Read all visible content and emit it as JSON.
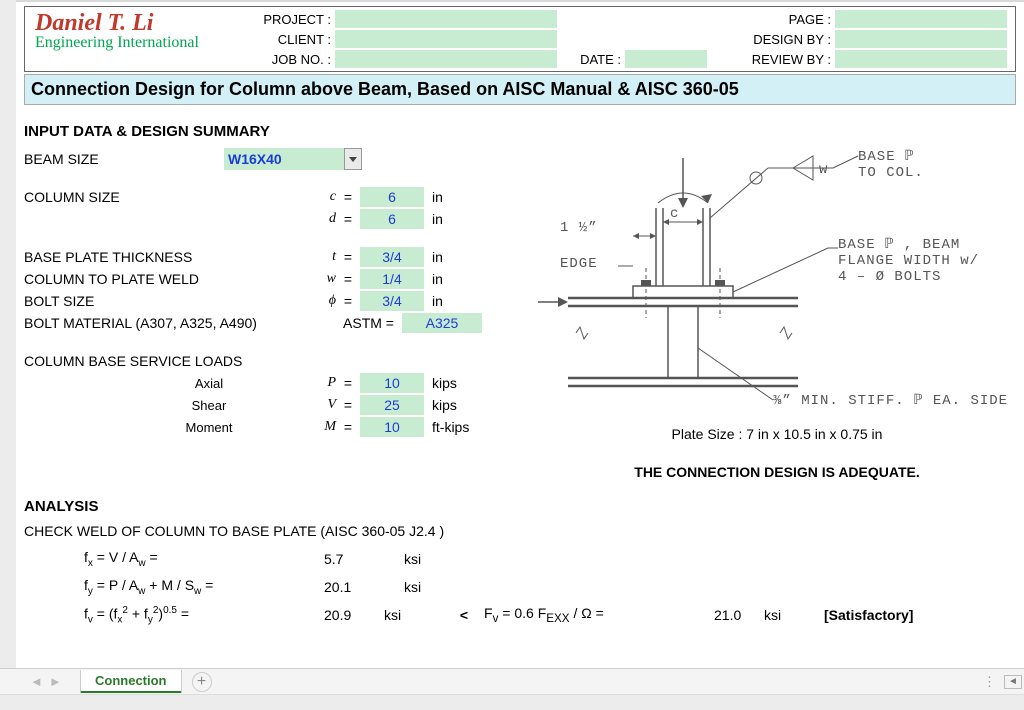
{
  "logo": {
    "name": "Daniel T. Li",
    "sub": "Engineering International"
  },
  "header": {
    "project": "PROJECT :",
    "client": "CLIENT :",
    "jobno": "JOB NO. :",
    "date": "DATE :",
    "page": "PAGE :",
    "design_by": "DESIGN BY :",
    "review_by": "REVIEW BY :"
  },
  "title": "Connection Design for Column above Beam, Based on AISC Manual & AISC 360-05",
  "sections": {
    "input": "INPUT DATA & DESIGN SUMMARY",
    "analysis": "ANALYSIS"
  },
  "beam": {
    "label": "BEAM SIZE",
    "value": "W16X40"
  },
  "column": {
    "label": "COLUMN SIZE",
    "c_sym": "c",
    "c_val": "6",
    "c_unit": "in",
    "d_sym": "d",
    "d_val": "6",
    "d_unit": "in"
  },
  "plate": {
    "t_label": "BASE PLATE THICKNESS",
    "t_sym": "t",
    "t_val": "3/4",
    "t_unit": "in",
    "w_label": "COLUMN TO PLATE WELD",
    "w_sym": "w",
    "w_val": "1/4",
    "w_unit": "in",
    "phi_label": "BOLT SIZE",
    "phi_sym": "ϕ",
    "phi_val": "3/4",
    "phi_unit": "in",
    "mat_label": "BOLT MATERIAL (A307, A325, A490)",
    "mat_prefix": "ASTM =",
    "mat_val": "A325"
  },
  "loads": {
    "title": "COLUMN BASE SERVICE LOADS",
    "axial_lbl": "Axial",
    "P_sym": "P",
    "P_val": "10",
    "P_unit": "kips",
    "shear_lbl": "Shear",
    "V_sym": "V",
    "V_val": "25",
    "V_unit": "kips",
    "moment_lbl": "Moment",
    "M_sym": "M",
    "M_val": "10",
    "M_unit": "ft-kips"
  },
  "diagram": {
    "base_to_col": "BASE ℙ\nTO COL.",
    "one_half": "1 ½”",
    "c": "c",
    "edge": "EDGE",
    "w": "w",
    "base_flange": "BASE ℙ , BEAM\nFLANGE WIDTH w/\n4 – Ø BOLTS",
    "stiff": "⅜” MIN. STIFF. ℙ EA. SIDE"
  },
  "result": {
    "plate_size": "Plate Size : 7 in  x 10.5 in  x 0.75 in",
    "adequate": "THE CONNECTION DESIGN IS ADEQUATE."
  },
  "analysis": {
    "check1": "CHECK WELD OF COLUMN TO BASE PLATE (AISC 360-05 J2.4 )",
    "fx": {
      "lhs": "f_x = V / A_w =",
      "val": "5.7",
      "unit": "ksi"
    },
    "fy": {
      "lhs": "f_y = P / A_w + M / S_w =",
      "val": "20.1",
      "unit": "ksi"
    },
    "fv": {
      "lhs": "f_v = (f_x^2 + f_y^2)^0.5 =",
      "val": "20.9",
      "unit": "ksi",
      "cmp": "<",
      "rhs": "F_v = 0.6 F_EXX / Ω =",
      "rhs_val": "21.0",
      "rhs_unit": "ksi",
      "status": "[Satisfactory]"
    }
  },
  "tabs": {
    "name": "Connection"
  }
}
